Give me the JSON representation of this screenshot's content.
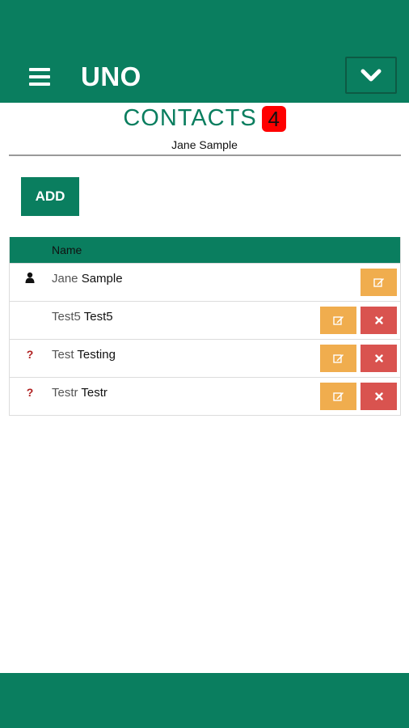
{
  "header": {
    "app_title": "UNO",
    "menu_icon": "hamburger-menu-icon",
    "dropdown_icon": "chevron-down-icon",
    "background_color": "#0a7e5f"
  },
  "page": {
    "title": "CONTACTS",
    "count": "4",
    "subtitle": "Jane Sample"
  },
  "toolbar": {
    "add_label": "ADD"
  },
  "table": {
    "columns": [
      "Name"
    ],
    "rows": [
      {
        "first": "Jane",
        "last": "Sample",
        "status_icon": "person-icon",
        "actions": [
          "edit"
        ]
      },
      {
        "first": "Test5",
        "last": "Test5",
        "status_icon": "",
        "actions": [
          "edit",
          "delete"
        ]
      },
      {
        "first": "Test",
        "last": "Testing",
        "status_icon": "question-icon",
        "actions": [
          "edit",
          "delete"
        ]
      },
      {
        "first": "Testr",
        "last": "Testr",
        "status_icon": "question-icon",
        "actions": [
          "edit",
          "delete"
        ]
      }
    ]
  },
  "colors": {
    "brand": "#0a7e5f",
    "edit": "#f0ad4e",
    "delete": "#d9534f",
    "badge": "#ff0000"
  }
}
